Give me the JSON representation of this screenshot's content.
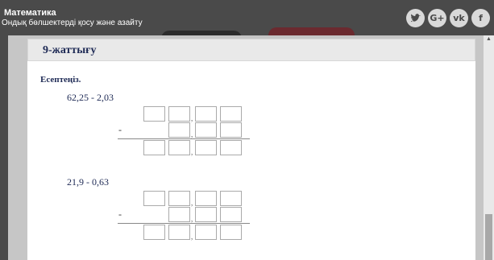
{
  "header": {
    "title": "Математика",
    "subtitle": "Ондық бөлшектерді қосу және азайту"
  },
  "social": [
    {
      "icon": "twitter-icon",
      "glyph": "🐦"
    },
    {
      "icon": "google-plus-icon",
      "glyph": "G+"
    },
    {
      "icon": "vk-icon",
      "glyph": "vk"
    },
    {
      "icon": "facebook-icon",
      "glyph": "f"
    }
  ],
  "exercise": {
    "title": "9-жаттығу",
    "instruction": "Есептеңіз.",
    "problems": [
      {
        "expression": "62,25 - 2,03",
        "minus": "-",
        "comma": ","
      },
      {
        "expression": "21,9 - 0,63",
        "minus": "-",
        "comma": ","
      }
    ]
  },
  "scrollbar": {
    "up_arrow": "▲"
  },
  "colors": {
    "header_bg": "#4a4a4a",
    "accent_text": "#1e2a55",
    "modal_bg": "#c6c6c6"
  }
}
